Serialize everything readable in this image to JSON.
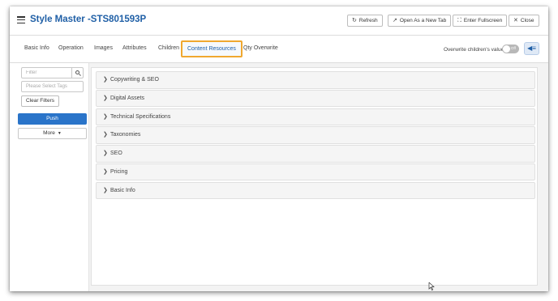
{
  "window": {
    "title": "Style Master -STS801593P"
  },
  "toolbar": {
    "refresh_label": "Refresh",
    "open_new_tab_label": "Open As a New Tab",
    "fullscreen_label": "Enter Fullscreen",
    "close_label": "Close"
  },
  "tabs": [
    {
      "label": "Basic Info"
    },
    {
      "label": "Operation"
    },
    {
      "label": "Images"
    },
    {
      "label": "Attributes"
    },
    {
      "label": "Children"
    },
    {
      "label": "Content Resources",
      "active": true
    },
    {
      "label": "Qty Overwrite"
    }
  ],
  "overwrite": {
    "label": "Overwrite children's value",
    "toggle_text": "Off",
    "state": "off"
  },
  "sidebar": {
    "filter_placeholder": "Filter",
    "tags_placeholder": "Please Select Tags",
    "clear_filters_label": "Clear Filters",
    "push_label": "Push",
    "more_label": "More"
  },
  "sections": [
    {
      "label": "Copywriting & SEO"
    },
    {
      "label": "Digital Assets"
    },
    {
      "label": "Technical Specifications"
    },
    {
      "label": "Taxonomies"
    },
    {
      "label": "SEO"
    },
    {
      "label": "Pricing"
    },
    {
      "label": "Basic Info"
    }
  ],
  "colors": {
    "accent": "#1f5fa6",
    "primary_button": "#2a74c9",
    "active_tab_border": "#f0a830"
  },
  "icons": {
    "menu": "hamburger-icon",
    "refresh": "refresh-icon",
    "open_new_tab": "external-link-icon",
    "fullscreen": "fullscreen-icon",
    "close": "close-icon",
    "search": "search-icon",
    "section_chevron": "chevron-right-icon"
  }
}
